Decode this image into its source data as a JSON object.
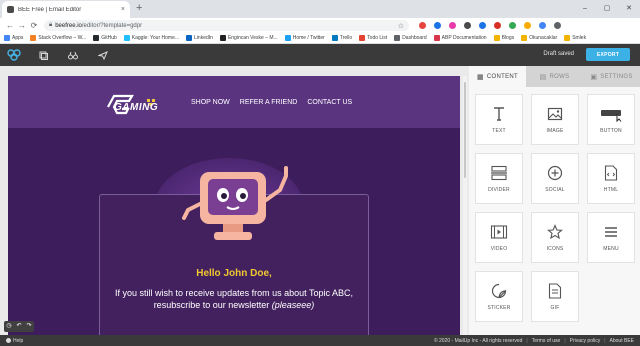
{
  "browser": {
    "tab_title": "BEE Free | Email Editor",
    "tab_close": "×",
    "new_tab": "+",
    "window_controls": [
      "–",
      "▢",
      "✕"
    ],
    "nav": [
      "←",
      "→",
      "⟳"
    ],
    "url_host": "beefree.io",
    "url_path": "/editor/?template=gdpr",
    "url_star": "☆",
    "extension_colors": [
      "#e8453c",
      "#1a73e8",
      "#e63ba8",
      "#4a4a4a",
      "#1a73e8",
      "#d93025",
      "#34a853",
      "#f9ab00",
      "#4285f4",
      "#5f6368"
    ]
  },
  "bookmarks": [
    {
      "label": "Apps",
      "color": "#4285f4"
    },
    {
      "label": "Stack Overflow – W...",
      "color": "#f48024"
    },
    {
      "label": "GitHub",
      "color": "#24292e"
    },
    {
      "label": "Kaggle: Your Home...",
      "color": "#20beff"
    },
    {
      "label": "LinkedIn",
      "color": "#0a66c2"
    },
    {
      "label": "Engincan Veske – M...",
      "color": "#222222"
    },
    {
      "label": "Home / Twitter",
      "color": "#1da1f2"
    },
    {
      "label": "Trello",
      "color": "#0079bf"
    },
    {
      "label": "Todo List",
      "color": "#e44332"
    },
    {
      "label": "Dashboard",
      "color": "#5f6368"
    },
    {
      "label": "ABP Documentation",
      "color": "#d8374b"
    },
    {
      "label": "Blogs",
      "color": "#f2b400"
    },
    {
      "label": "Okunacaklar",
      "color": "#f2b400"
    },
    {
      "label": "Smlek",
      "color": "#f2b400"
    }
  ],
  "editor": {
    "status": "Draft saved",
    "export_label": "EXPORT"
  },
  "email": {
    "brand": "GAMING",
    "nav": [
      "SHOP NOW",
      "REFER A FRIEND",
      "CONTACT US"
    ],
    "greeting": "Hello John Doe,",
    "message": "If you still wish to receive updates from us about Topic ABC, resubscribe to our newsletter",
    "message_em": "(pleaseee)",
    "accent_color": "#f2c830",
    "background_color": "#3e1d5c"
  },
  "panel": {
    "tabs": [
      "CONTENT",
      "ROWS",
      "SETTINGS"
    ],
    "blocks": [
      "TEXT",
      "IMAGE",
      "BUTTON",
      "DIVIDER",
      "SOCIAL",
      "HTML",
      "VIDEO",
      "ICONS",
      "MENU",
      "STICKER",
      "GIF"
    ]
  },
  "footer": {
    "help": "Help",
    "copyright": "© 2020 - MailUp Inc - All rights reserved",
    "separator": "|",
    "links": [
      "Terms of use",
      "Privacy policy",
      "About BEE"
    ]
  },
  "undo_icons": [
    "◷",
    "↶",
    "↷"
  ]
}
